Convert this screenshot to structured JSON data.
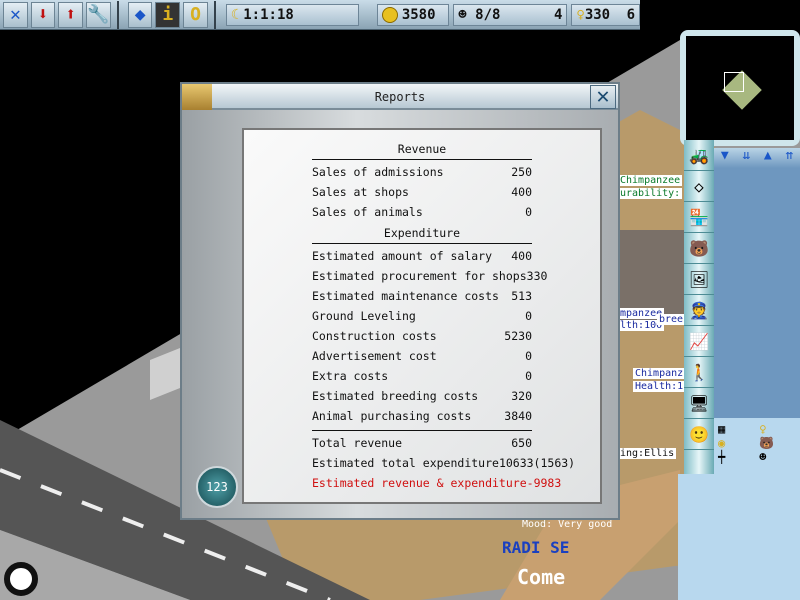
{
  "toolbar": {
    "buttons": [
      "close",
      "save",
      "load",
      "settings",
      "layers",
      "info",
      "ring"
    ],
    "date": "1:1:18",
    "money": "3580",
    "visitors": "8/8",
    "visitors_extra": "4",
    "keys": "330",
    "keys_extra": "6"
  },
  "dialog": {
    "title": "Reports",
    "close_label": "✕",
    "badge": "123",
    "revenue_header": "Revenue",
    "revenue": [
      {
        "label": "Sales of admissions",
        "value": "250"
      },
      {
        "label": "Sales at shops",
        "value": "400"
      },
      {
        "label": "Sales of animals",
        "value": "0"
      }
    ],
    "expenditure_header": "Expenditure",
    "expenditure": [
      {
        "label": "Estimated amount of salary",
        "value": "400"
      },
      {
        "label": "Estimated procurement for shops",
        "value": "330"
      },
      {
        "label": "Estimated maintenance costs",
        "value": "513"
      },
      {
        "label": "Ground Leveling",
        "value": "0"
      },
      {
        "label": "Construction costs",
        "value": "5230"
      },
      {
        "label": "Advertisement cost",
        "value": "0"
      },
      {
        "label": "Extra costs",
        "value": "0"
      },
      {
        "label": "Estimated breeding costs",
        "value": "320"
      },
      {
        "label": "Animal purchasing costs",
        "value": "3840"
      }
    ],
    "totals": [
      {
        "label": "Total revenue",
        "value": "650"
      },
      {
        "label": "Estimated total expenditure",
        "value": "10633(1563)"
      }
    ],
    "net": {
      "label": "Estimated revenue & expenditure",
      "value": "-9983"
    }
  },
  "map_labels": {
    "l1": "Chimpanzee",
    "l2": "urability:",
    "l3": "mpanzee",
    "l4": "lth:100",
    "l5": "bree",
    "l6": "Chimpanz",
    "l7": "Health:1",
    "l8": "ing:Ellis",
    "l9": "Mood: Very good",
    "sign": "Come",
    "sign2": "RADI SE"
  },
  "panel": {
    "arrows": [
      "▼",
      "⇊",
      "▲",
      "⇈"
    ]
  }
}
